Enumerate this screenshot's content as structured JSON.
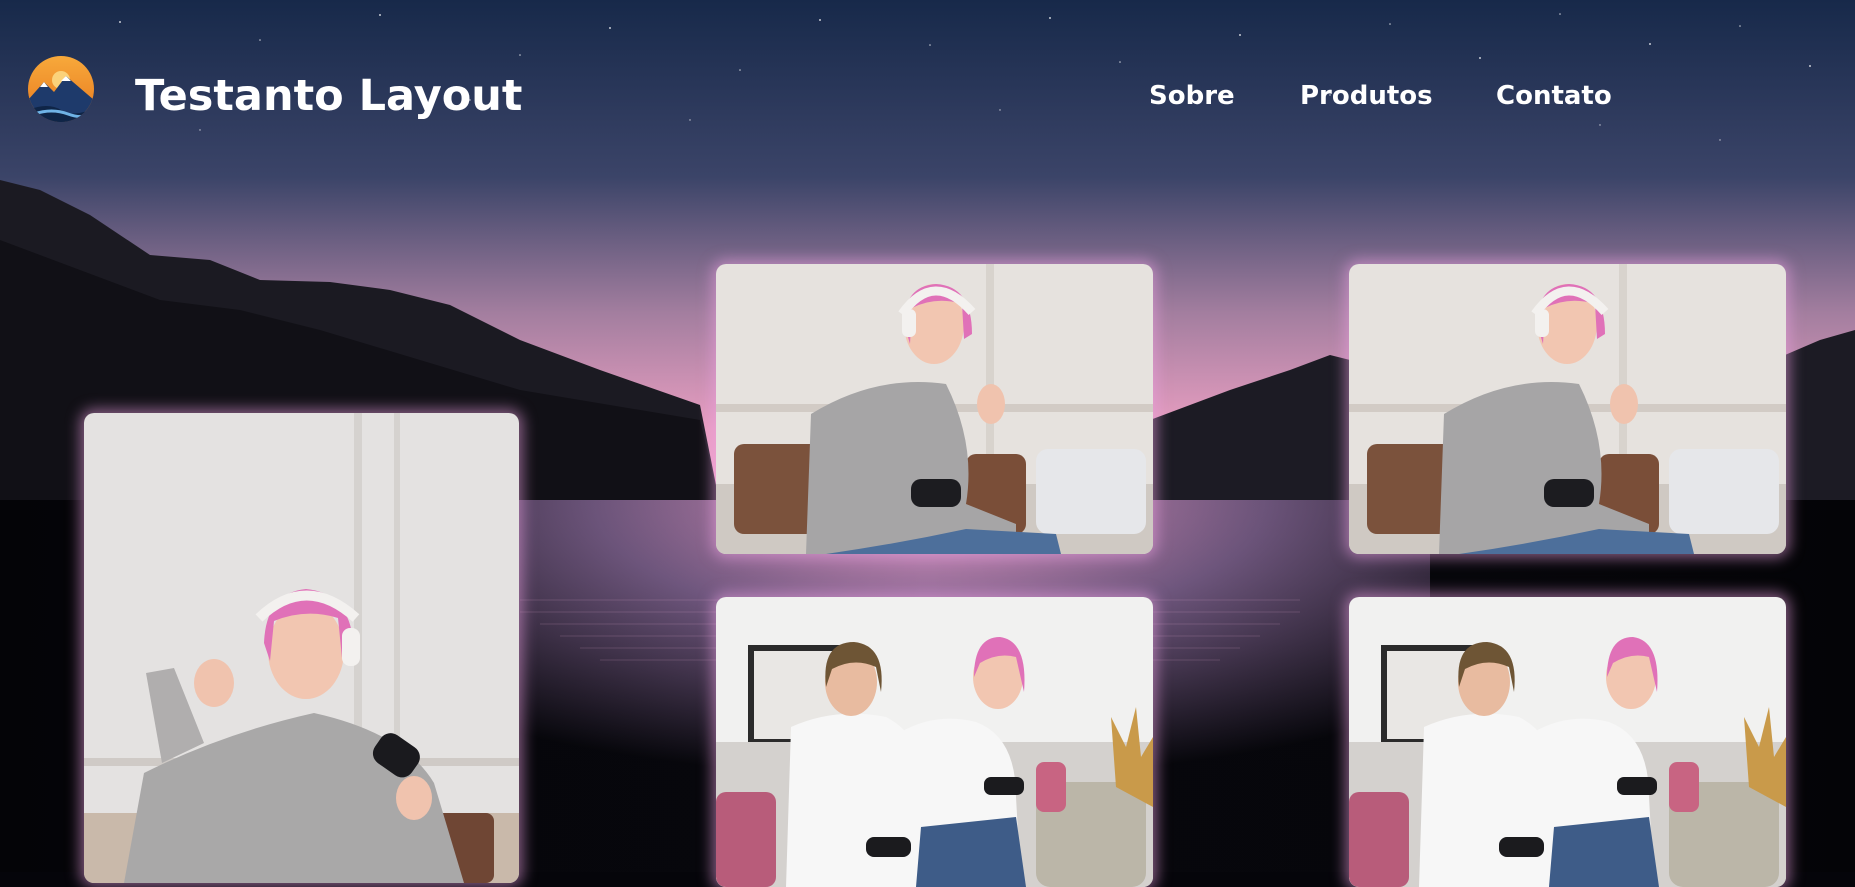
{
  "header": {
    "site_title": "Testanto Layout",
    "logo_icon": "mountain-sunset-logo"
  },
  "nav": {
    "items": [
      {
        "label": "Sobre"
      },
      {
        "label": "Produtos"
      },
      {
        "label": "Contato"
      }
    ]
  },
  "colors": {
    "sky_top": "#1a2c4e",
    "sky_horizon": "#f3a3c8",
    "water": "#07070c",
    "nav_text": "#ffffff",
    "card_glow": "#eba0e1"
  },
  "gallery": {
    "images": [
      {
        "subject": "woman with pink hair holding game controller, rock gesture"
      },
      {
        "subject": "woman with pink hair and headphones playing video game"
      },
      {
        "subject": "woman with pink hair and headphones playing video game"
      },
      {
        "subject": "man and woman playing video games on sofa"
      },
      {
        "subject": "man and woman playing video games on sofa"
      }
    ]
  }
}
